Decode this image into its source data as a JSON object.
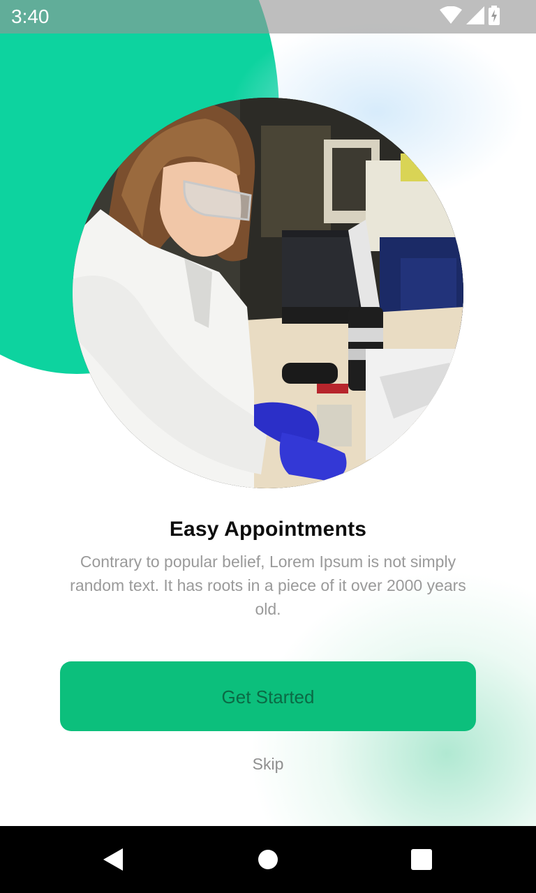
{
  "status_bar": {
    "time": "3:40",
    "icons": [
      "wifi-icon",
      "cellular-signal-icon",
      "battery-charging-icon"
    ]
  },
  "onboarding": {
    "title": "Easy Appointments",
    "description": "Contrary to popular belief, Lorem Ipsum is not simply random text. It has roots in a piece of it over 2000 years old.",
    "primary_button_label": "Get Started",
    "skip_label": "Skip"
  },
  "navigation_bar": {
    "icons": [
      "back-icon",
      "home-icon",
      "recents-icon"
    ]
  },
  "colors": {
    "accent_green": "#0cbf7c",
    "blob_green": "#0dd39f",
    "button_text": "#0b6a45",
    "title_text": "#0d0d0d",
    "body_text": "#9a9a9a"
  }
}
